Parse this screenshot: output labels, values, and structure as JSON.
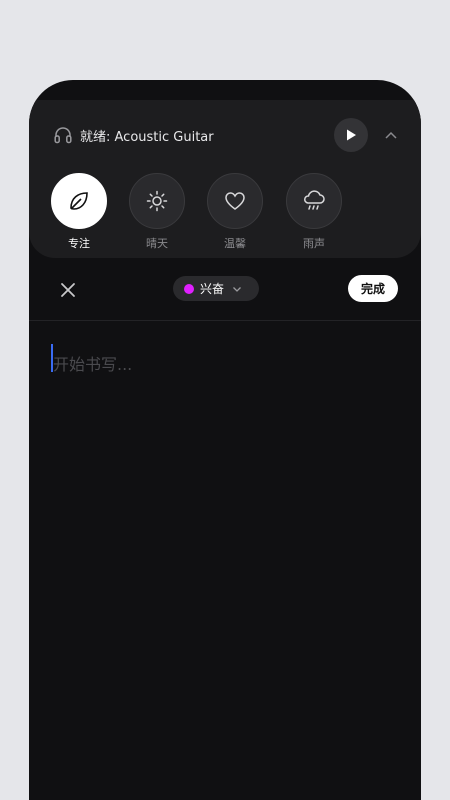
{
  "player": {
    "now_playing": "就绪: Acoustic Guitar",
    "icons": {
      "headphones": "headphones-icon",
      "play": "play-icon",
      "collapse": "chevron-up-icon"
    }
  },
  "sounds": [
    {
      "label": "专注",
      "icon": "leaf-icon",
      "active": true
    },
    {
      "label": "晴天",
      "icon": "sun-icon",
      "active": false
    },
    {
      "label": "温馨",
      "icon": "heart-icon",
      "active": false
    },
    {
      "label": "雨声",
      "icon": "cloud-rain-icon",
      "active": false
    }
  ],
  "toolbar": {
    "mood_label": "兴奋",
    "mood_color": "#e020ff",
    "done_label": "完成"
  },
  "editor": {
    "placeholder": "开始书写..."
  },
  "colors": {
    "accent_caret": "#3a6cf4",
    "background": "#101012",
    "panel": "#1d1d1f"
  }
}
